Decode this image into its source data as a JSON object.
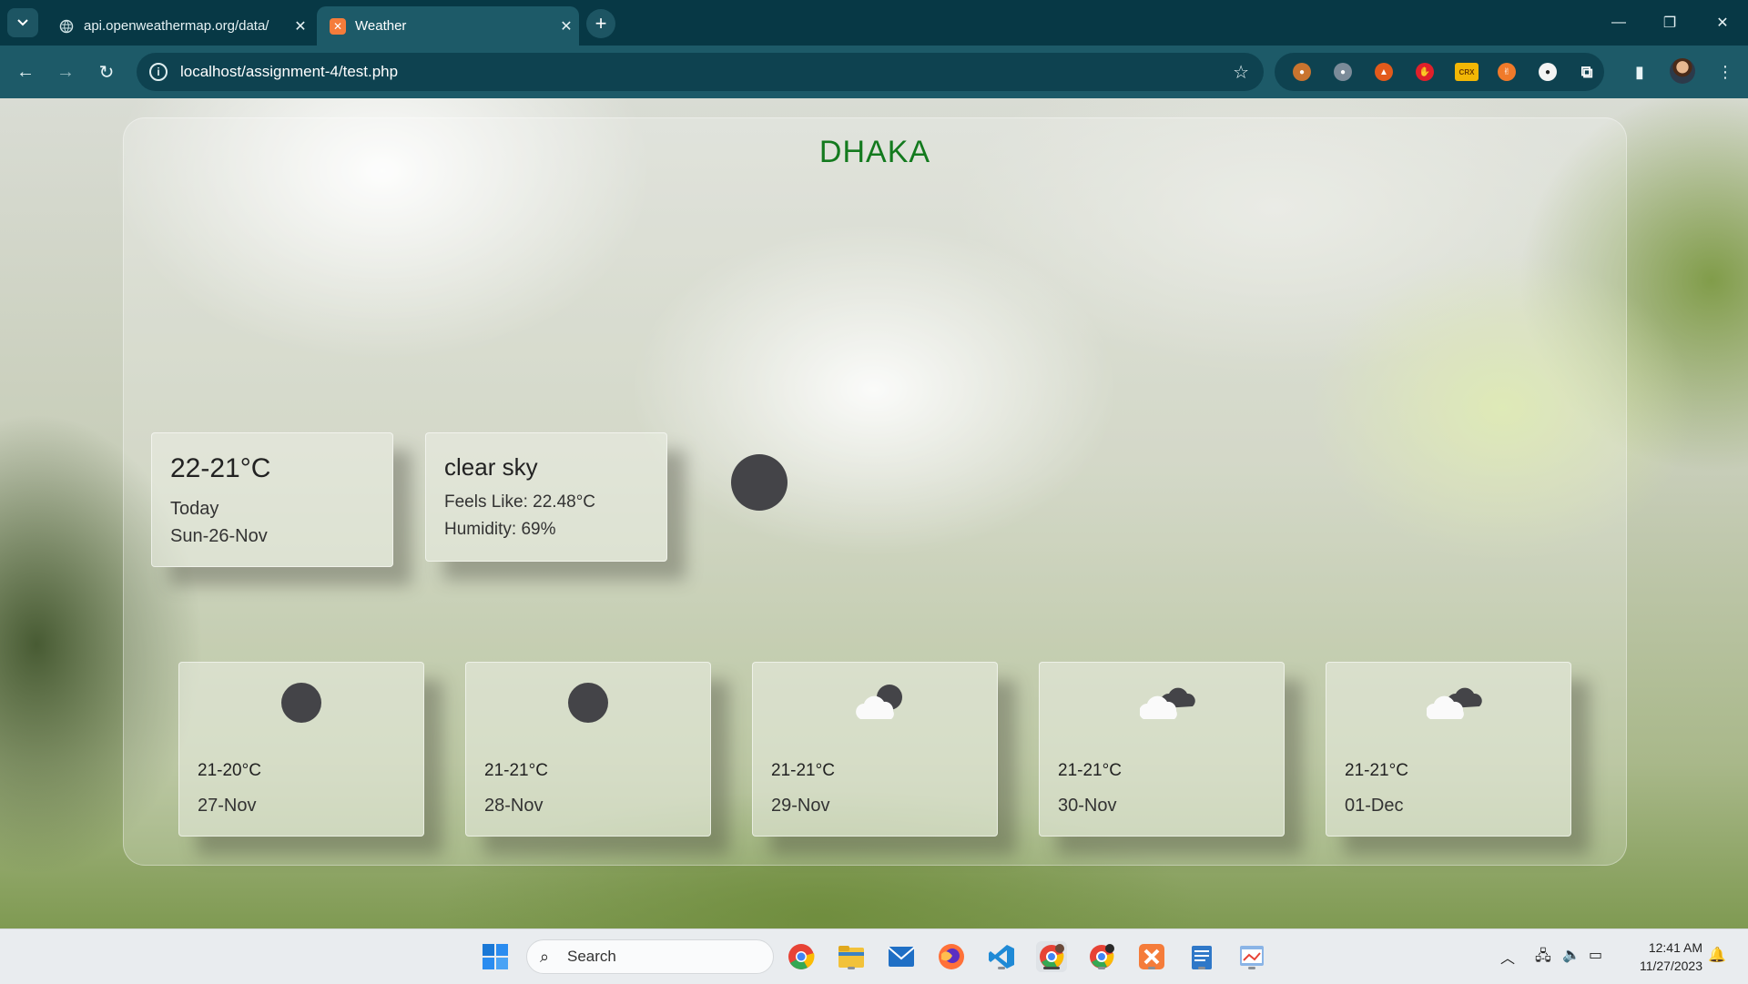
{
  "browser": {
    "tabs": [
      {
        "title": "api.openweathermap.org/data/",
        "active": false
      },
      {
        "title": "Weather",
        "active": true
      }
    ],
    "address": "localhost/assignment-4/test.php",
    "accent": "#1d5a68"
  },
  "weather": {
    "city": "DHAKA",
    "today": {
      "temp": "22-21°C",
      "day": "Today",
      "date": "Sun-26-Nov"
    },
    "current": {
      "description": "clear sky",
      "feels_like": "Feels Like: 22.48°C",
      "humidity": "Humidity: 69%"
    },
    "forecast": [
      {
        "temp": "21-20°C",
        "date": "27-Nov",
        "icon": "moon-icon"
      },
      {
        "temp": "21-21°C",
        "date": "28-Nov",
        "icon": "moon-icon"
      },
      {
        "temp": "21-21°C",
        "date": "29-Nov",
        "icon": "cloud-moon-icon"
      },
      {
        "temp": "21-21°C",
        "date": "30-Nov",
        "icon": "cloudy-icon"
      },
      {
        "temp": "21-21°C",
        "date": "01-Dec",
        "icon": "cloudy-icon"
      }
    ]
  },
  "taskbar": {
    "search_label": "Search",
    "time": "12:41 AM",
    "date": "11/27/2023"
  }
}
